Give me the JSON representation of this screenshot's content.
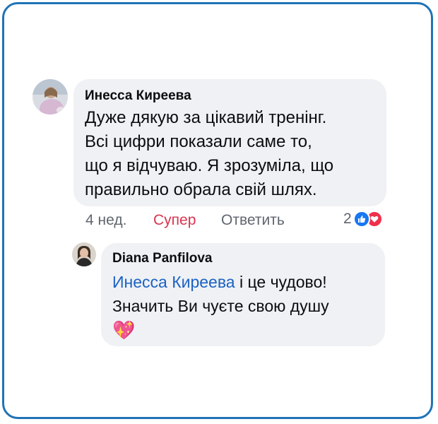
{
  "comment": {
    "author": "Инесса Киреева",
    "lines": [
      "Дуже дякую за цікавий тренінг.",
      "Всі цифри показали саме то,",
      "що я відчуваю. Я зрозуміла, що",
      "правильно обрала свій шлях."
    ],
    "time": "4 нед.",
    "reaction_label": "Супер",
    "reply_label": "Ответить",
    "reaction_count": "2",
    "reaction_icons": [
      "like-icon",
      "heart-icon"
    ],
    "reaction_color": "#d9344f"
  },
  "reply": {
    "author": "Diana Panfilova",
    "mention": "Инесса Киреева",
    "line1_rest": " і це чудово!",
    "line2": "Значить Ви чуєте свою душу",
    "emoji": "💖",
    "mention_color": "#1c62c4"
  },
  "colors": {
    "frame": "#1f73b7",
    "bubble": "#eff1f4",
    "like": "#1877f2",
    "heart": "#f0304b"
  }
}
